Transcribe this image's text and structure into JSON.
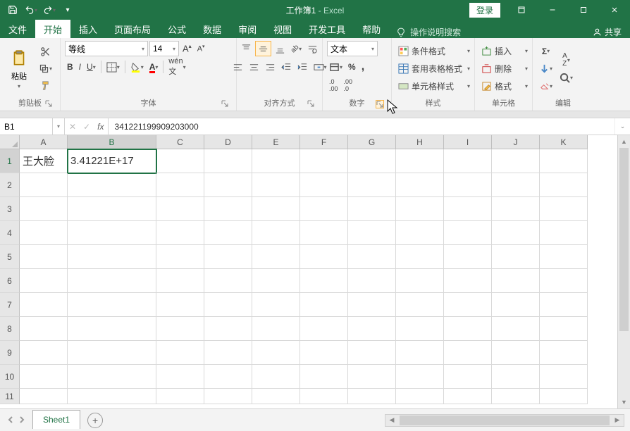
{
  "titlebar": {
    "doc": "工作簿1",
    "sep": " - ",
    "app": "Excel",
    "login": "登录"
  },
  "tabs": {
    "file": "文件",
    "home": "开始",
    "insert": "插入",
    "layout": "页面布局",
    "formulas": "公式",
    "data": "数据",
    "review": "审阅",
    "view": "视图",
    "dev": "开发工具",
    "help": "帮助",
    "tell": "操作说明搜索",
    "share": "共享"
  },
  "ribbon": {
    "clipboard": {
      "paste": "粘贴",
      "label": "剪贴板"
    },
    "font": {
      "name": "等线",
      "size": "14",
      "label": "字体"
    },
    "align": {
      "label": "对齐方式"
    },
    "number": {
      "format": "文本",
      "label": "数字"
    },
    "styles": {
      "cond": "条件格式",
      "table": "套用表格格式",
      "cell": "单元格样式",
      "label": "样式"
    },
    "cells": {
      "insert": "插入",
      "delete": "删除",
      "format": "格式",
      "label": "单元格"
    },
    "editing": {
      "label": "编辑"
    }
  },
  "namebox": "B1",
  "formula": "341221199909203000",
  "columns": [
    "A",
    "B",
    "C",
    "D",
    "E",
    "F",
    "G",
    "H",
    "I",
    "J",
    "K"
  ],
  "rows": [
    "1",
    "2",
    "3",
    "4",
    "5",
    "6",
    "7",
    "8",
    "9",
    "10",
    "11"
  ],
  "active": {
    "col": "B",
    "row": "1"
  },
  "cells": {
    "A1": "王大脸",
    "B1": "3.41221E+17"
  },
  "sheet": {
    "name": "Sheet1"
  },
  "icons": {
    "save": "save-icon",
    "undo": "undo-icon",
    "redo": "redo-icon",
    "qat_dd": "chevron-down-icon",
    "ribbon_opts": "ribbon-display-icon",
    "min": "minimize-icon",
    "max": "maximize-icon",
    "close": "close-icon",
    "bulb": "lightbulb-icon",
    "person": "person-icon",
    "cut": "scissors-icon",
    "copy": "copy-icon",
    "brush": "format-painter-icon",
    "paste": "clipboard-paste-icon",
    "incfont": "increase-font-icon",
    "decfont": "decrease-font-icon",
    "bold": "bold-icon",
    "italic": "italic-icon",
    "underline": "underline-icon",
    "border": "border-icon",
    "fill": "fill-color-icon",
    "fontcolor": "font-color-icon",
    "phonetic": "phonetic-icon",
    "al_tl": "align-top-icon",
    "al_tm": "align-middle-icon",
    "al_tr": "align-bottom-icon",
    "al_l": "align-left-icon",
    "al_c": "align-center-icon",
    "al_r": "align-right-icon",
    "orient": "orientation-icon",
    "wrap": "wrap-text-icon",
    "outdent": "decrease-indent-icon",
    "indent": "increase-indent-icon",
    "merge": "merge-icon",
    "acct": "accounting-icon",
    "pct": "percent-icon",
    "comma": "comma-icon",
    "incdec": "increase-decimal-icon",
    "decdec": "decrease-decimal-icon",
    "cond": "conditional-format-icon",
    "tblf": "table-format-icon",
    "cellst": "cell-styles-icon",
    "ins": "insert-cells-icon",
    "del": "delete-cells-icon",
    "fmt": "format-cells-icon",
    "sum": "autosum-icon",
    "filldown": "fill-down-icon",
    "clear": "clear-icon",
    "sort": "sort-filter-icon",
    "find": "find-icon",
    "cancel": "cancel-icon",
    "enter": "enter-icon",
    "fx": "fx-icon",
    "expand": "expand-icon",
    "prev": "nav-prev-icon",
    "next": "nav-next-icon",
    "plus": "add-sheet-icon"
  }
}
